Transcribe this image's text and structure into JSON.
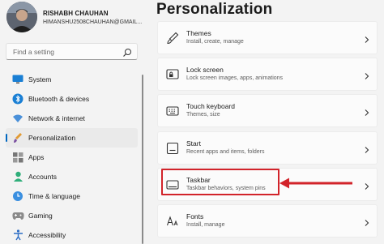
{
  "user": {
    "name": "RISHABH CHAUHAN",
    "email": "HIMANSHU2508CHAUHAN@GMAIL..."
  },
  "search": {
    "placeholder": "Find a setting"
  },
  "nav": [
    {
      "label": "System",
      "icon": "monitor-icon",
      "active": false
    },
    {
      "label": "Bluetooth & devices",
      "icon": "bluetooth-icon",
      "active": false
    },
    {
      "label": "Network & internet",
      "icon": "wifi-icon",
      "active": false
    },
    {
      "label": "Personalization",
      "icon": "brush-icon",
      "active": true
    },
    {
      "label": "Apps",
      "icon": "apps-icon",
      "active": false
    },
    {
      "label": "Accounts",
      "icon": "person-icon",
      "active": false
    },
    {
      "label": "Time & language",
      "icon": "globe-clock-icon",
      "active": false
    },
    {
      "label": "Gaming",
      "icon": "gamepad-icon",
      "active": false
    },
    {
      "label": "Accessibility",
      "icon": "accessibility-icon",
      "active": false
    }
  ],
  "page": {
    "title": "Personalization"
  },
  "cards": [
    {
      "title": "Themes",
      "subtitle": "Install, create, manage",
      "icon": "brush-icon"
    },
    {
      "title": "Lock screen",
      "subtitle": "Lock screen images, apps, animations",
      "icon": "lock-screen-icon"
    },
    {
      "title": "Touch keyboard",
      "subtitle": "Themes, size",
      "icon": "keyboard-icon"
    },
    {
      "title": "Start",
      "subtitle": "Recent apps and items, folders",
      "icon": "start-icon"
    },
    {
      "title": "Taskbar",
      "subtitle": "Taskbar behaviors, system pins",
      "icon": "taskbar-icon"
    },
    {
      "title": "Fonts",
      "subtitle": "Install, manage",
      "icon": "fonts-icon"
    }
  ],
  "colors": {
    "accent": "#0067c0",
    "annotation": "#d2232a",
    "background": "#f3f3f3",
    "card": "#fbfbfb"
  }
}
